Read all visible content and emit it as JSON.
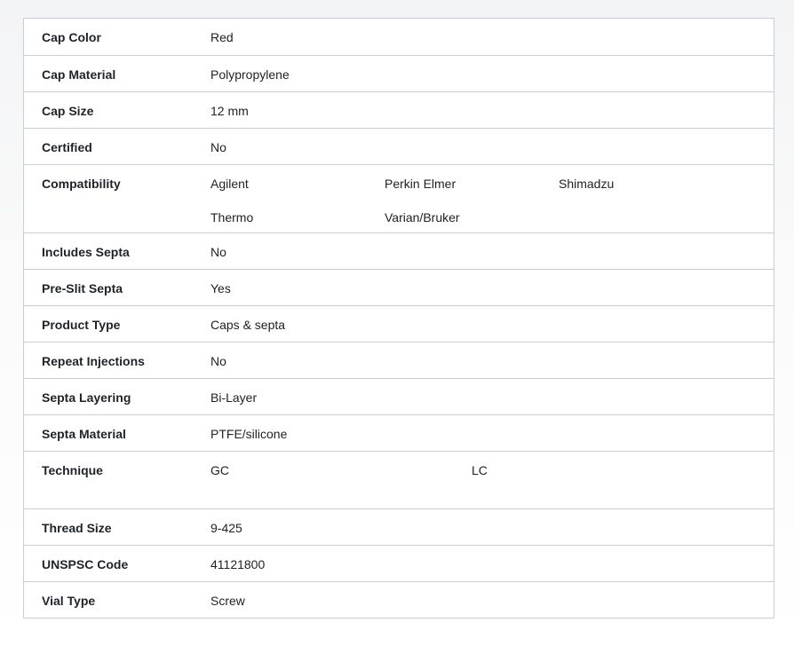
{
  "specs": {
    "cap_color": {
      "label": "Cap Color",
      "value": "Red"
    },
    "cap_material": {
      "label": "Cap Material",
      "value": "Polypropylene"
    },
    "cap_size": {
      "label": "Cap Size",
      "value": "12 mm"
    },
    "certified": {
      "label": "Certified",
      "value": "No"
    },
    "compatibility": {
      "label": "Compatibility",
      "values": [
        "Agilent",
        "Perkin Elmer",
        "Shimadzu",
        "Thermo",
        "Varian/Bruker"
      ]
    },
    "includes_septa": {
      "label": "Includes Septa",
      "value": "No"
    },
    "pre_slit_septa": {
      "label": "Pre-Slit Septa",
      "value": "Yes"
    },
    "product_type": {
      "label": "Product Type",
      "value": "Caps & septa"
    },
    "repeat_injections": {
      "label": "Repeat Injections",
      "value": "No"
    },
    "septa_layering": {
      "label": "Septa Layering",
      "value": "Bi-Layer"
    },
    "septa_material": {
      "label": "Septa Material",
      "value": "PTFE/silicone"
    },
    "technique": {
      "label": "Technique",
      "values": [
        "GC",
        "LC"
      ]
    },
    "thread_size": {
      "label": "Thread Size",
      "value": "9-425"
    },
    "unspsc_code": {
      "label": "UNSPSC Code",
      "value": "41121800"
    },
    "vial_type": {
      "label": "Vial Type",
      "value": "Screw"
    }
  }
}
